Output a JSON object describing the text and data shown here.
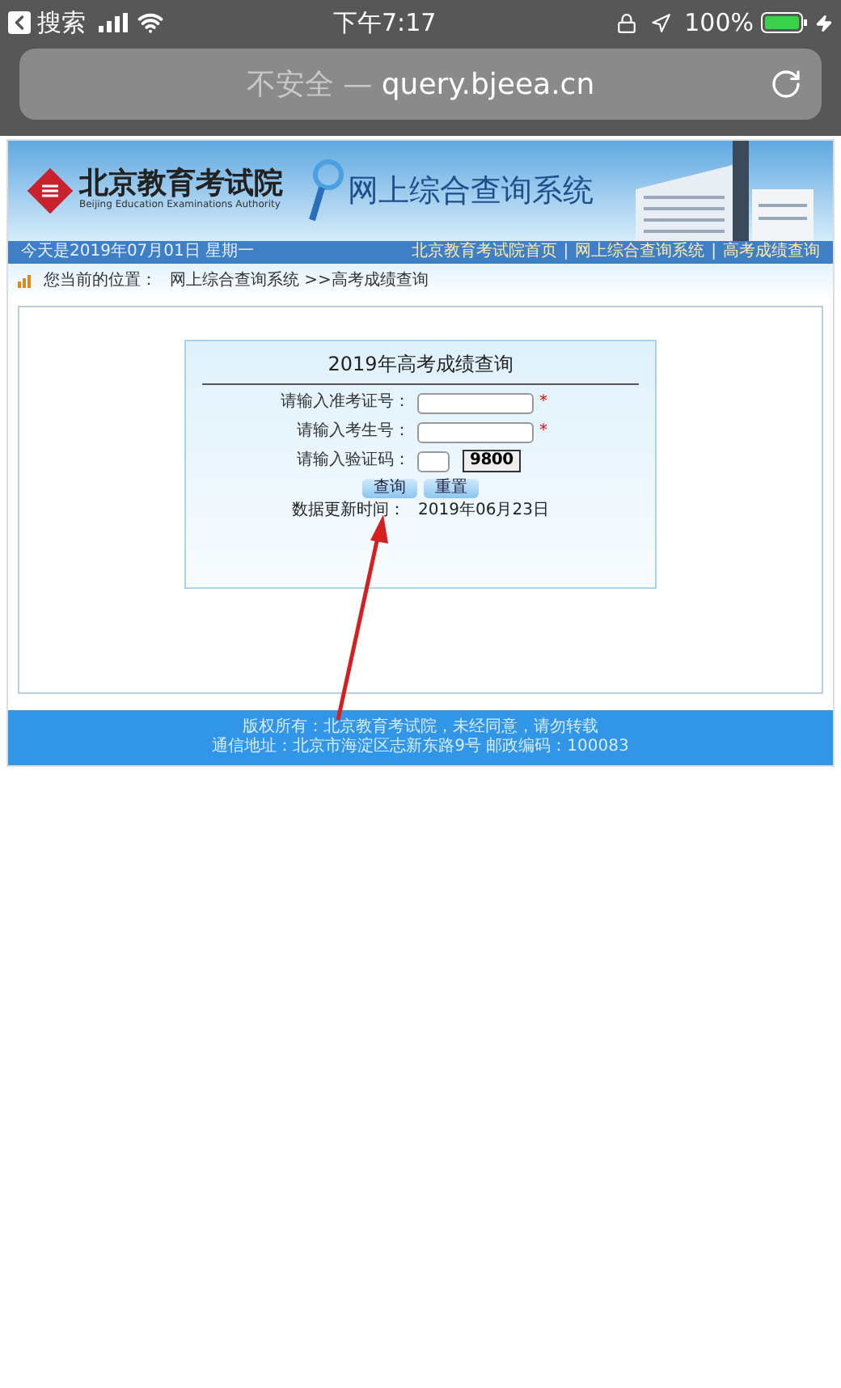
{
  "status_bar": {
    "back_label": "搜索",
    "time": "下午7:17",
    "battery": "100%"
  },
  "address_bar": {
    "security": "不安全 —",
    "url": "query.bjeea.cn"
  },
  "header": {
    "logo_cn": "北京教育考试院",
    "logo_en": "Beijing Education Examinations Authority",
    "system_title": "网上综合查询系统"
  },
  "nav_bar": {
    "date": "今天是2019年07月01日 星期一",
    "links": [
      "北京教育考试院首页",
      "网上综合查询系统",
      "高考成绩查询"
    ],
    "separator": "|"
  },
  "breadcrumb": {
    "label": "您当前的位置：",
    "path": "网上综合查询系统 >>高考成绩查询"
  },
  "form": {
    "title": "2019年高考成绩查询",
    "fields": [
      {
        "kind": "text",
        "label": "请输入准考证号：",
        "required": true
      },
      {
        "kind": "text",
        "label": "请输入考生号：",
        "required": true
      },
      {
        "kind": "captcha",
        "label": "请输入验证码：",
        "required": false,
        "captcha": "9800"
      }
    ],
    "required_mark": "*",
    "buttons": [
      "查询",
      "重置"
    ],
    "update_label": "数据更新时间：",
    "update_date": "2019年06月23日"
  },
  "footer": [
    "版权所有：北京教育考试院，未经同意，请勿转载",
    "通信地址：北京市海淀区志新东路9号 邮政编码：100083"
  ]
}
